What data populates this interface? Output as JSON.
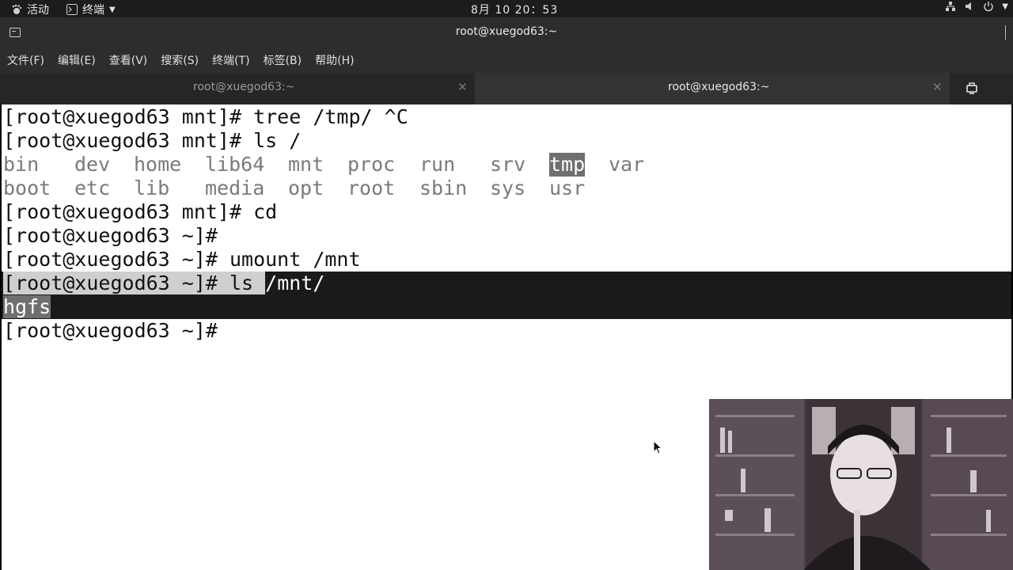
{
  "topbar": {
    "activities": "活动",
    "app_menu": "终端",
    "clock": "8月 10 20：53"
  },
  "window": {
    "title": "root@xuegod63:~"
  },
  "menubar": {
    "items": [
      "文件(F)",
      "编辑(E)",
      "查看(V)",
      "搜索(S)",
      "终端(T)",
      "标签(B)",
      "帮助(H)"
    ]
  },
  "tabs": [
    {
      "label": "root@xuegod63:~",
      "active": false
    },
    {
      "label": "root@xuegod63:~",
      "active": true
    }
  ],
  "terminal": {
    "line1": "[root@xuegod63 mnt]# tree /tmp/ ^C",
    "line2": "[root@xuegod63 mnt]# ls /",
    "ls_row1": [
      "bin",
      "dev",
      "home",
      "lib64",
      "mnt",
      "proc",
      "run",
      "srv",
      "tmp",
      "var"
    ],
    "ls_row2": [
      "boot",
      "etc",
      "lib",
      "media",
      "opt",
      "root",
      "sbin",
      "sys",
      "usr"
    ],
    "line5": "[root@xuegod63 mnt]# cd",
    "line6": "[root@xuegod63 ~]#",
    "line7": "[root@xuegod63 ~]# umount /mnt",
    "line8_prompt": "[root@xuegod63 ~]# ls ",
    "line8_arg": "/mnt/",
    "line9": "hgfs",
    "line10": "[root@xuegod63 ~]#"
  },
  "colors": {
    "topbar_bg": "#1c1c1c",
    "chrome_bg": "#2d2d2d",
    "terminal_bg": "#ffffff",
    "terminal_fg": "#111111",
    "selection_bg": "#1a1a1a"
  }
}
